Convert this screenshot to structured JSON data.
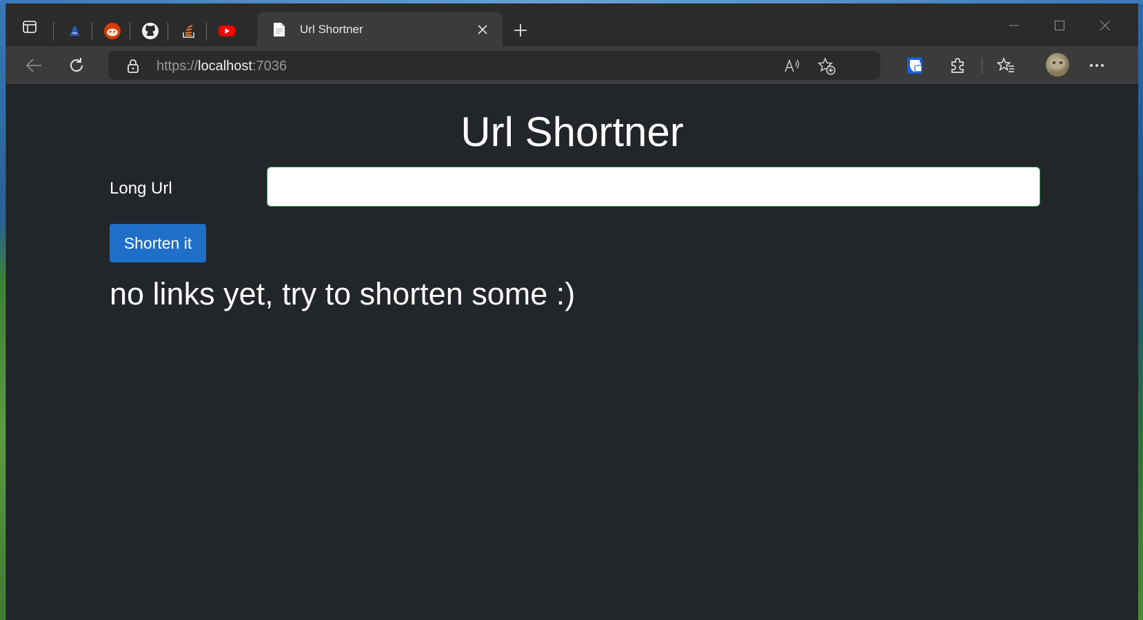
{
  "browser": {
    "tabs": [
      {
        "title": "Url Shortner",
        "active": true
      }
    ],
    "address": {
      "scheme": "https://",
      "host": "localhost",
      "port": ":7036"
    },
    "icons": {
      "tab_actions": "tab-actions-icon",
      "pinned": [
        "azure-devops-icon",
        "reddit-icon",
        "github-icon",
        "stackoverflow-icon",
        "youtube-icon"
      ],
      "toolbar": [
        "back-icon",
        "refresh-icon",
        "lock-icon",
        "read-aloud-icon",
        "add-favorite-icon",
        "bitwarden-icon",
        "extensions-icon",
        "favorites-icon",
        "profile-avatar",
        "more-icon"
      ]
    },
    "colors": {
      "page_bg": "#222529",
      "input_border": "#2fa84f",
      "button_bg": "#1f6fc8"
    }
  },
  "page": {
    "title": "Url Shortner",
    "long_url_label": "Long Url",
    "long_url_value": "",
    "shorten_button": "Shorten it",
    "empty_message": "no links yet, try to shorten some :)"
  }
}
